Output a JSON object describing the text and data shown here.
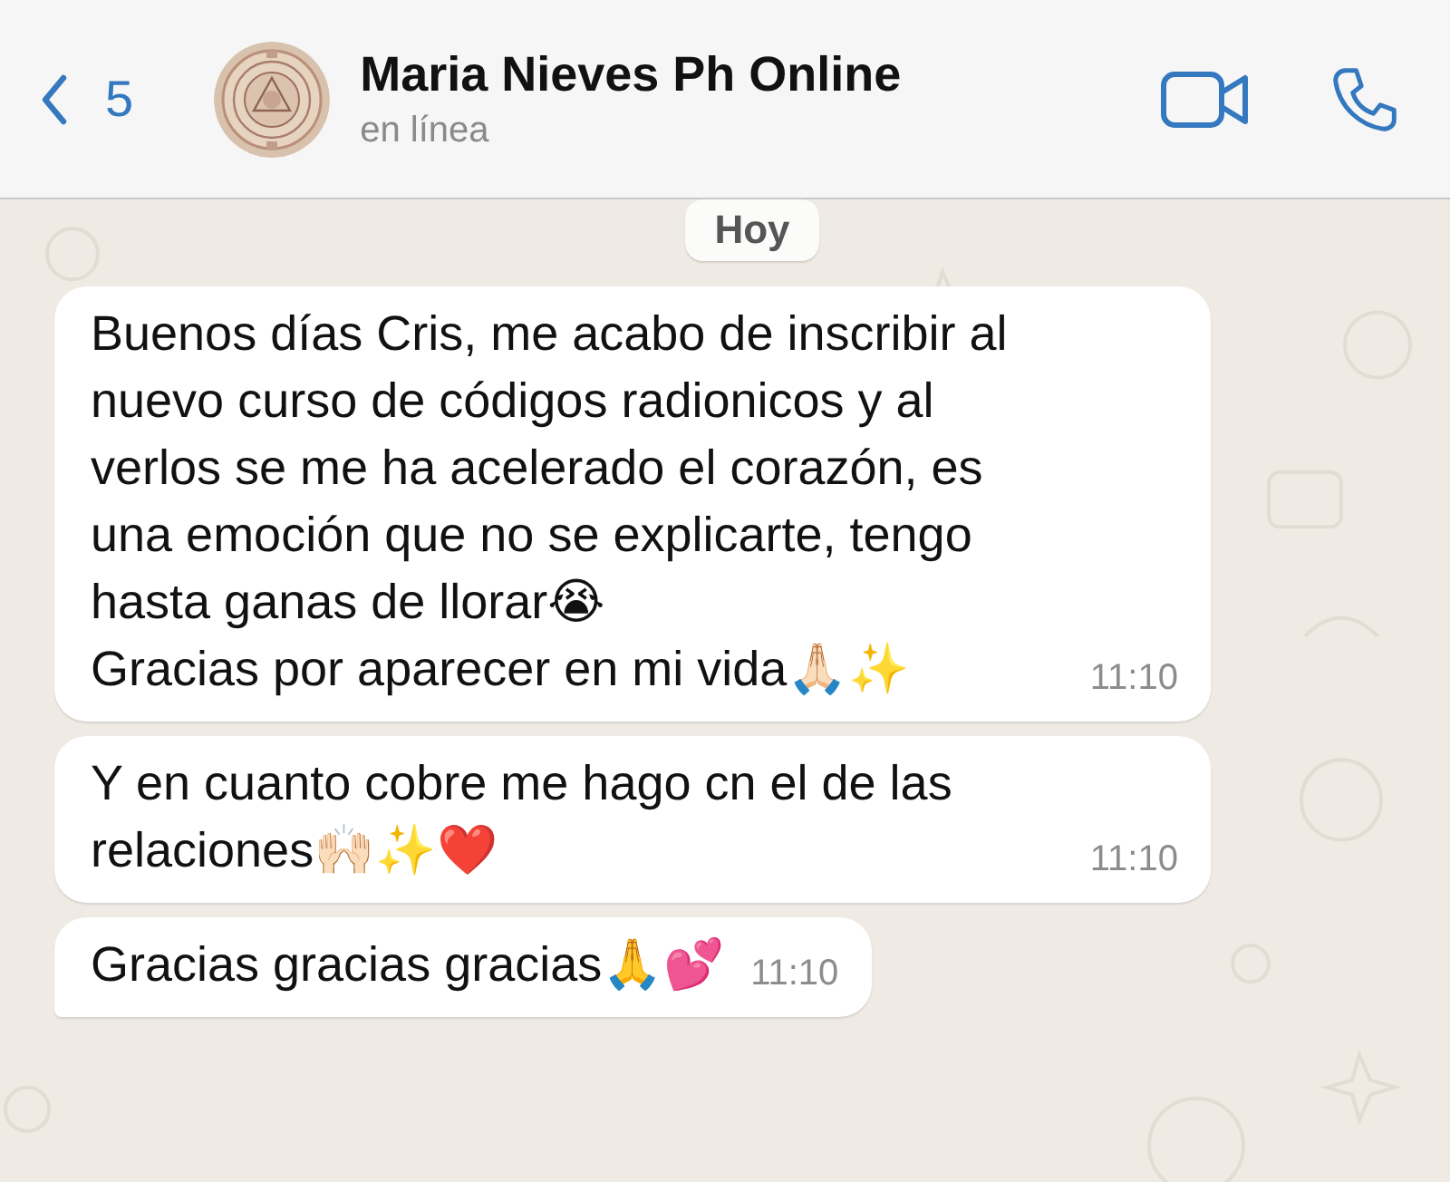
{
  "header": {
    "back_count": "5",
    "contact_name": "Maria Nieves Ph Online",
    "status": "en línea"
  },
  "date_chip": "Hoy",
  "messages": [
    {
      "text": "Buenos días Cris, me acabo de inscribir al nuevo curso de códigos radionicos y al verlos se me ha acelerado el corazón, es una emoción que no se explicarte, tengo hasta ganas de llorar😭\nGracias por aparecer en mi vida🙏🏻✨",
      "time": "11:10",
      "tail": false
    },
    {
      "text": "Y en cuanto cobre me hago cn el de las relaciones🙌🏻✨❤️",
      "time": "11:10",
      "tail": false
    },
    {
      "text": "Gracias gracias gracias🙏💕",
      "time": "11:10",
      "tail": true
    }
  ]
}
